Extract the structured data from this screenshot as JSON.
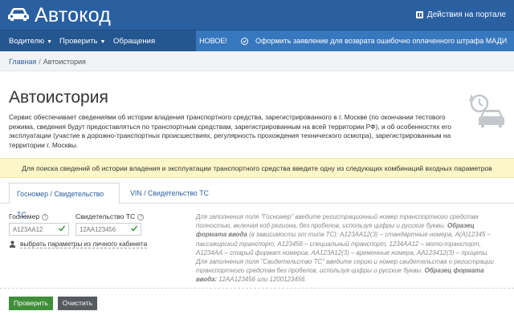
{
  "header": {
    "logo_text": "Автокод",
    "logo_icon": "car-icon",
    "portal_actions": "Действия на портале"
  },
  "nav": {
    "items": [
      {
        "label": "Водителю",
        "caret": "▼"
      },
      {
        "label": "Проверить",
        "caret": "▼"
      },
      {
        "label": "Обращения",
        "caret": ""
      }
    ],
    "news_badge": "НОВОЕ!",
    "news_text": "Оформить заявление для возврата ошибочно оплаченного штрафа МАДИ"
  },
  "breadcrumb": {
    "home": "Главная",
    "separator": "/",
    "current": "Автоистория"
  },
  "page": {
    "title": "Автоистория",
    "description": "Сервис обеспечивает сведениями об истории владения транспортного средства, зарегистрированного в г. Москве (по окончании тестового режима, сведения будут предоставляться по транспортным средствам, зарегистрированным на всей территории РФ), и об особенностях его эксплуатации (участие в дорожно-транспортных происшествиях, регулярность прохождения технического осмотра), зарегистрированным на территории г. Москвы.",
    "notice": "Для поиска сведений об истории владения и эксплуатации транспортного средства введите одну из следующих комбинаций входных параметров"
  },
  "tabs": [
    {
      "label": "Госномер / Свидетельство ТС",
      "active": true
    },
    {
      "label": "VIN / Свидетельство ТС",
      "active": false
    }
  ],
  "form": {
    "gosnomer_label": "Госномер",
    "gosnomer_placeholder": "А123АА12",
    "svid_label": "Свидетельство ТС",
    "svid_placeholder": "12АА123456",
    "cabinet_link": "выбрать параметры из личного кабинета",
    "help_p1": "Для заполнения поля \"Госномер\" введите регистрационный номер транспортного средства полностью, включая код региона, без пробелов, используя цифры и русские буквы.",
    "help_p1_bold": "Образец формата ввода",
    "help_p1_rest": "(в зависимости от типа ТС): А123АА12(3) – стандартные номера, А(А)12345 – пассажирский транспорт, А123456 – специальный транспорт, 1234АА12 – мото-транспорт, А1234АА – старый формат номеров, АА123А12(3) – временные номера, АА123412(3) – прицепы.",
    "help_p2": "Для заполнения поля \"Свидетельство ТС\" введите серию и номер свидетельства о регистрации транспортного средства без пробелов, используя цифры и русские буквы.",
    "help_p2_bold": "Образец формата ввода:",
    "help_p2_rest": "12АА123456 или 1200123456."
  },
  "buttons": {
    "check": "Проверить",
    "clear": "Очистить"
  },
  "colors": {
    "header": "#2a5fa0",
    "accent": "#3777bd",
    "notice_bg": "#fdf6c8",
    "check_btn": "#3f8e3a",
    "clear_btn": "#555a5f"
  }
}
